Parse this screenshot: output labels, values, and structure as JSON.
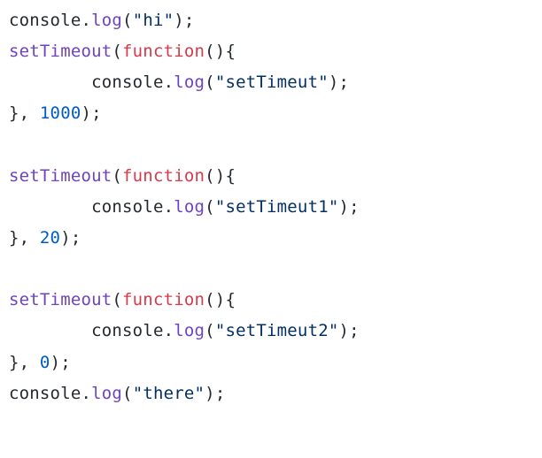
{
  "code": {
    "console": "console",
    "log": "log",
    "setTimeout": "setTimeout",
    "function": "function",
    "str_hi": "\"hi\"",
    "str_setTimeut": "\"setTimeut\"",
    "str_setTimeut1": "\"setTimeut1\"",
    "str_setTimeut2": "\"setTimeut2\"",
    "str_there": "\"there\"",
    "num_1000": "1000",
    "num_20": "20",
    "num_0": "0",
    "paren_open": "(",
    "paren_close": ")",
    "brace_open": "{",
    "brace_close": "}",
    "dot": ".",
    "semi": ";",
    "comma": ", ",
    "indent": "        "
  }
}
